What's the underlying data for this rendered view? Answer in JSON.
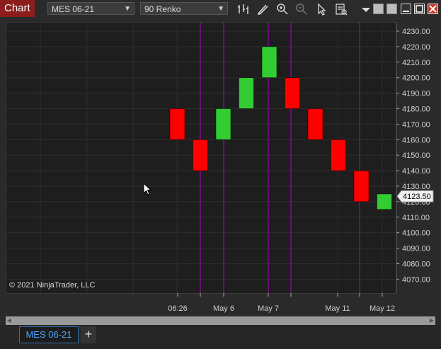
{
  "app": {
    "title": "Chart"
  },
  "toolbar": {
    "instrument": "MES 06-21",
    "bar_type": "90 Renko",
    "icons": [
      "bar-type-icon",
      "drawing-tool-icon",
      "zoom-in-icon",
      "zoom-out-icon",
      "pointer-icon",
      "data-box-icon",
      "dropdown-icon",
      "minimize-icon",
      "maximize-icon",
      "close-icon"
    ]
  },
  "watermark": "© 2021 NinjaTrader, LLC",
  "price_axis": {
    "labels": [
      "4230.00",
      "4220.00",
      "4210.00",
      "4200.00",
      "4190.00",
      "4180.00",
      "4170.00",
      "4160.00",
      "4150.00",
      "4140.00",
      "4130.00",
      "4120.00",
      "4110.00",
      "4100.00",
      "4090.00",
      "4080.00",
      "4070.00"
    ],
    "current_price": "4123.50"
  },
  "time_axis": {
    "labels": [
      "06:26",
      "May 6",
      "May 7",
      "May 11",
      "May 12"
    ]
  },
  "colors": {
    "up": "#33cc33",
    "down": "#ff0000",
    "session_line": "#b000c8",
    "price_marker_bg": "#f0f0f0"
  },
  "chart_data": {
    "type": "renko",
    "brick_size": 20,
    "bricks": [
      {
        "open": 4180,
        "close": 4160,
        "dir": "down"
      },
      {
        "open": 4160,
        "close": 4140,
        "dir": "down"
      },
      {
        "open": 4160,
        "close": 4180,
        "dir": "up"
      },
      {
        "open": 4180,
        "close": 4200,
        "dir": "up"
      },
      {
        "open": 4200,
        "close": 4220,
        "dir": "up"
      },
      {
        "open": 4200,
        "close": 4180,
        "dir": "down"
      },
      {
        "open": 4180,
        "close": 4160,
        "dir": "down"
      },
      {
        "open": 4160,
        "close": 4140,
        "dir": "down"
      },
      {
        "open": 4140,
        "close": 4120,
        "dir": "down"
      },
      {
        "open": 4120,
        "close": 4123.5,
        "dir": "up"
      }
    ],
    "ylim": [
      4062,
      4234
    ],
    "current_price": 4123.5
  },
  "bottom_tabs": {
    "active": "MES 06-21",
    "add_label": "+"
  }
}
